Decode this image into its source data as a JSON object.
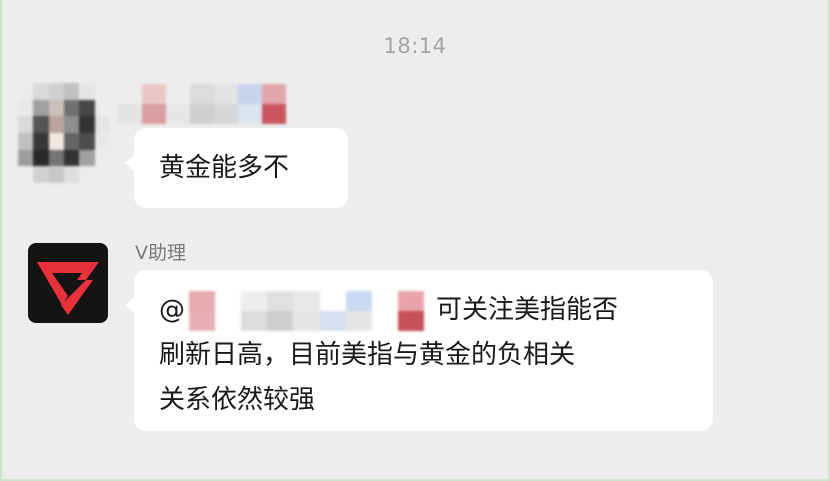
{
  "chat": {
    "timestamp": "18:14",
    "messages": [
      {
        "sender": "",
        "text": "黄金能多不"
      },
      {
        "sender": "V助理",
        "mention_prefix": "@",
        "lines": [
          "可关注美指能否",
          "刷新日高，目前美指与黄金的负相关",
          "关系依然较强"
        ]
      }
    ]
  },
  "colors": {
    "background": "#ededed",
    "bubble": "#ffffff",
    "bot_logo_red": "#e8313a",
    "bot_logo_bg": "#141414"
  },
  "icons": {
    "bot_avatar": "v-logo-icon"
  }
}
